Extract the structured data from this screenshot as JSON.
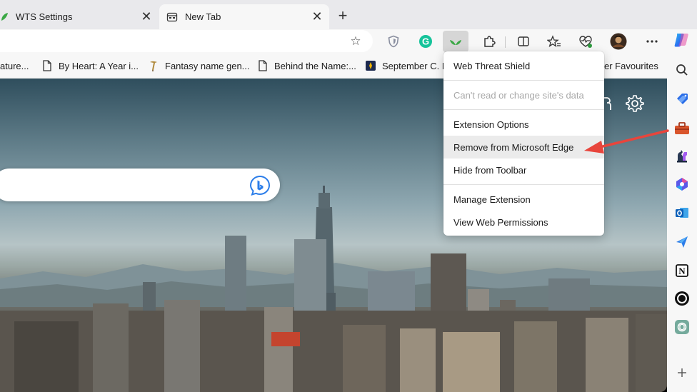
{
  "tabs": [
    {
      "title": "WTS Settings",
      "favicon": "wts-leaf-icon",
      "active": false
    },
    {
      "title": "New Tab",
      "favicon": "newtab-icon",
      "active": true
    }
  ],
  "toolbar": {
    "address_value": "",
    "extensions": [
      "shield-icon",
      "grammarly-icon",
      "wts-extension-icon",
      "puzzle-icon",
      "split-screen-icon",
      "favorites-icon",
      "browser-essentials-icon",
      "profile-avatar",
      "more-icon"
    ]
  },
  "bookmarks": [
    {
      "label": "ature...",
      "icon": "page-icon"
    },
    {
      "label": "By Heart: A Year i...",
      "icon": "page-icon"
    },
    {
      "label": "Fantasy name gen...",
      "icon": "fantasy-icon"
    },
    {
      "label": "Behind the Name:...",
      "icon": "page-icon"
    },
    {
      "label": "September C. F",
      "icon": "bookmark-favicon"
    },
    {
      "label": "er Favourites",
      "icon": ""
    }
  ],
  "menu": {
    "items": [
      {
        "label": "Web Threat Shield",
        "disabled": false
      },
      {
        "label": "Can't read or change site's data",
        "disabled": true
      },
      {
        "label": "Extension Options",
        "disabled": false
      },
      {
        "label": "Remove from Microsoft Edge",
        "disabled": false,
        "hover": true
      },
      {
        "label": "Hide from Toolbar",
        "disabled": false
      },
      {
        "label": "Manage Extension",
        "disabled": false
      },
      {
        "label": "View Web Permissions",
        "disabled": false
      }
    ]
  },
  "sidebar": {
    "items": [
      "search-icon",
      "shopping-tag-icon",
      "tools-icon",
      "games-icon",
      "microsoft365-icon",
      "outlook-icon",
      "send-icon",
      "notion-icon",
      "circle-app-icon",
      "chatgpt-icon",
      "add-icon"
    ]
  },
  "colors": {
    "annotation_arrow": "#e8453c",
    "menu_hover": "#ebebeb",
    "wts_green": "#3aa845"
  }
}
